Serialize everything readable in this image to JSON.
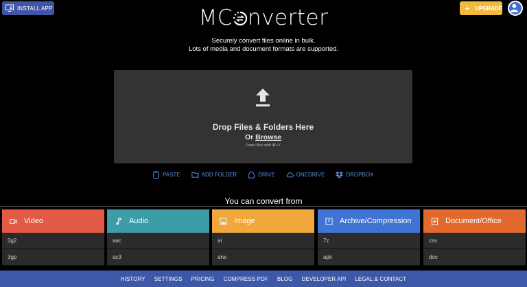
{
  "header": {
    "install_label": "INSTALL APP",
    "logo_text_left": "MC",
    "logo_text_right": "nverter",
    "upgrade_label": "UPGRADE"
  },
  "tagline": {
    "line1": "Securely convert files online in bulk.",
    "line2": "Lots of media and document formats are supported."
  },
  "dropzone": {
    "title": "Drop Files & Folders Here",
    "or": "Or",
    "browse": "Browse",
    "hint": "Paste files with ⌘+V"
  },
  "sources": [
    {
      "label": "PASTE",
      "icon": "clipboard-icon"
    },
    {
      "label": "ADD FOLDER",
      "icon": "folder-icon"
    },
    {
      "label": "DRIVE",
      "icon": "drive-icon"
    },
    {
      "label": "ONEDRIVE",
      "icon": "cloud-icon"
    },
    {
      "label": "DROPBOX",
      "icon": "dropbox-icon"
    }
  ],
  "convert_from": "You can convert from",
  "categories": [
    {
      "name": "Video",
      "color": "#e35a46",
      "icon": "video-icon",
      "items": [
        "3g2",
        "3gp"
      ]
    },
    {
      "name": "Audio",
      "color": "#3d9da6",
      "icon": "music-note-icon",
      "items": [
        "aac",
        "ac3"
      ]
    },
    {
      "name": "Image",
      "color": "#f0a73c",
      "icon": "image-icon",
      "items": [
        "ai",
        "arw"
      ]
    },
    {
      "name": "Archive/Compression",
      "color": "#3f74d4",
      "icon": "archive-icon",
      "items": [
        "7z",
        "apk"
      ]
    },
    {
      "name": "Document/Office",
      "color": "#e36a2f",
      "icon": "document-icon",
      "items": [
        "csv",
        "doc"
      ]
    }
  ],
  "footer": [
    "HISTORY",
    "SETTINGS",
    "PRICING",
    "COMPRESS PDF",
    "BLOG",
    "DEVELOPER API",
    "LEGAL & CONTACT"
  ],
  "colors": {
    "install_bg": "#3f56a6",
    "upgrade_bg": "#f3b93b",
    "link_blue": "#5b8fd9",
    "footer_bg": "#3e58a8"
  }
}
